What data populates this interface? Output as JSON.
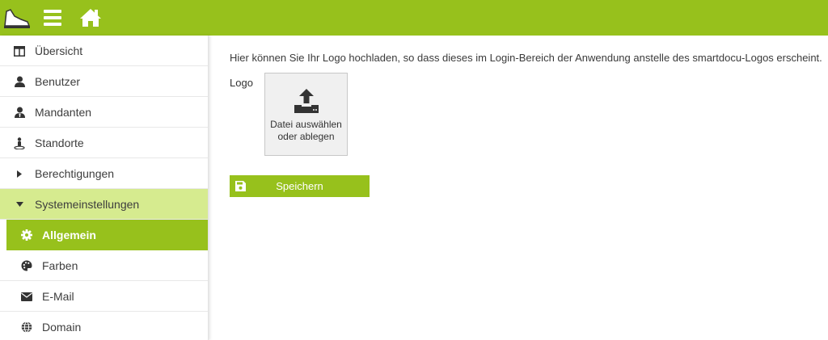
{
  "colors": {
    "accent": "#97c11c",
    "accent_light": "#d6eb8f",
    "text": "#3d3d3d"
  },
  "topbar": {
    "logo_icon": "shoe-logo-icon",
    "menu_icon": "hamburger-menu-icon",
    "home_icon": "home-icon"
  },
  "sidebar": {
    "items": [
      {
        "label": "Übersicht",
        "icon": "table-icon"
      },
      {
        "label": "Benutzer",
        "icon": "user-icon"
      },
      {
        "label": "Mandanten",
        "icon": "user-tie-icon"
      },
      {
        "label": "Standorte",
        "icon": "person-pin-icon"
      },
      {
        "label": "Berechtigungen",
        "icon": "caret-right-icon"
      },
      {
        "label": "Systemeinstellungen",
        "icon": "caret-down-icon"
      }
    ],
    "subitems": [
      {
        "label": "Allgemein",
        "icon": "gear-icon",
        "active": true
      },
      {
        "label": "Farben",
        "icon": "palette-icon"
      },
      {
        "label": "E-Mail",
        "icon": "envelope-icon"
      },
      {
        "label": "Domain",
        "icon": "globe-icon"
      }
    ]
  },
  "main": {
    "description": "Hier können Sie Ihr Logo hochladen, so dass dieses im Login-Bereich der Anwendung anstelle des smartdocu-Logos erscheint.",
    "logo_label": "Logo",
    "dropzone_line1": "Datei auswählen",
    "dropzone_line2": "oder ablegen",
    "save_label": "Speichern"
  }
}
